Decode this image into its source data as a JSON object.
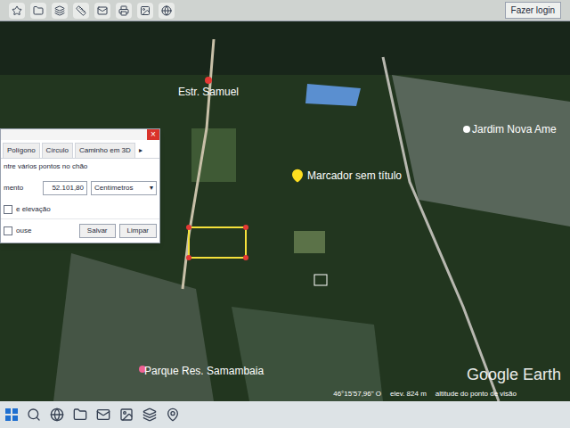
{
  "toolbar": {
    "login": "Fazer login"
  },
  "map": {
    "labels": [
      {
        "text": "Estr. Samuel",
        "color": "#e53935"
      },
      {
        "text": "Jardim Nova Ame",
        "color": "#ffffff"
      },
      {
        "text": "Parque Res. Samambaia",
        "color": "#f06292"
      }
    ],
    "placemark": {
      "label": "Marcador sem título"
    },
    "watermark": "Google Earth"
  },
  "measure_dialog": {
    "close": "×",
    "tabs": [
      {
        "label": "Polígono",
        "selected": false
      },
      {
        "label": "Círculo",
        "selected": false
      },
      {
        "label": "Caminho em 3D",
        "selected": false
      }
    ],
    "more": "▸",
    "instruction": "ntre vários pontos no chão",
    "field_label": "mento",
    "value": "52.101,80",
    "unit": "Centímetros",
    "unit_arrow": "▾",
    "elevation_label": "e elevação",
    "elevation_checked": false,
    "mouse_label": "ouse",
    "mouse_checked": false,
    "buttons": [
      "Salvar",
      "Limpar"
    ]
  },
  "status_bar": {
    "coords": "46°15'57,96\" O",
    "elevation": "elev. 824 m",
    "eye_alt": "altitude do ponto de visão"
  }
}
